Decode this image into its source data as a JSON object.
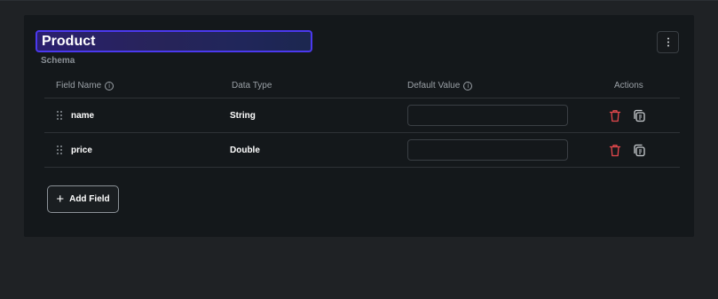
{
  "schema": {
    "title": "Product",
    "subtitle": "Schema",
    "more_icon": "more-vertical-icon"
  },
  "table": {
    "headers": {
      "field_name": "Field Name",
      "data_type": "Data Type",
      "default_value": "Default Value",
      "actions": "Actions"
    },
    "rows": [
      {
        "name": "name",
        "type": "String",
        "default_value": ""
      },
      {
        "name": "price",
        "type": "Double",
        "default_value": ""
      }
    ]
  },
  "add_field": {
    "label": "Add Field",
    "icon": "+"
  },
  "colors": {
    "accent": "#4b39ef",
    "danger": "#e5484d",
    "card": "#14181b",
    "page": "#1f2225"
  }
}
